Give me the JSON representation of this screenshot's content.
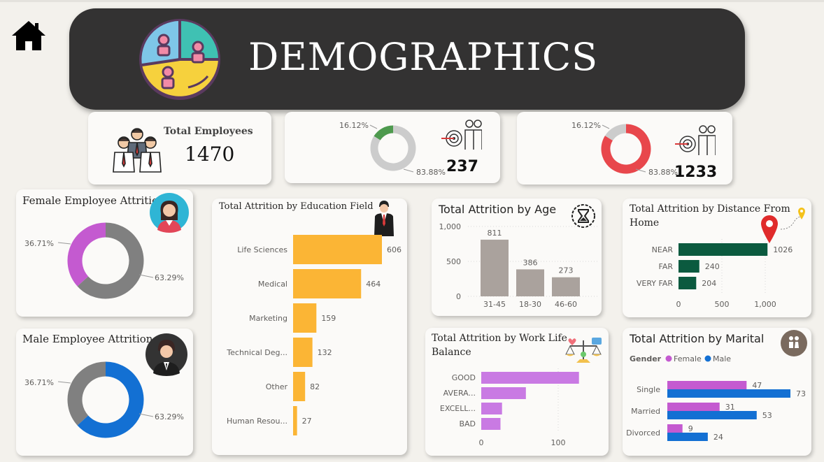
{
  "page": {
    "title": "DEMOGRAPHICS",
    "home_icon": "home-icon",
    "header_icon": "people-pie-icon"
  },
  "kpis": {
    "total_employees": {
      "label": "Total Employees",
      "value": "1470",
      "icon": "employees-group-icon"
    },
    "attrition_yes": {
      "value": "237",
      "pct_small": "16.12%",
      "pct_large": "83.88%",
      "small_fraction": 0.1612,
      "accent": "#4e9a4e",
      "icon": "target-team-icon"
    },
    "attrition_no": {
      "value": "1233",
      "pct_small": "16.12%",
      "pct_large": "83.88%",
      "small_fraction": 0.1612,
      "accent": "#e8474c",
      "icon": "target-team-icon"
    }
  },
  "female_attrition": {
    "title": "Female Employee Attrition",
    "icon": "female-avatar-icon",
    "pct_a": "36.71%",
    "pct_b": "63.29%",
    "fraction_a": 0.3671,
    "color_a": "#c45ad0",
    "color_b": "#808080"
  },
  "male_attrition": {
    "title": "Male Employee Attrition",
    "icon": "male-avatar-icon",
    "pct_a": "36.71%",
    "pct_b": "63.29%",
    "fraction_a": 0.3671,
    "color_a": "#808080",
    "color_b": "#1370d3"
  },
  "education": {
    "title": "Total Attrition by Education Field",
    "icon": "businessman-icon",
    "categories": [
      "Life Sciences",
      "Medical",
      "Marketing",
      "Technical Deg...",
      "Other",
      "Human Resou..."
    ],
    "values": [
      606,
      464,
      159,
      132,
      82,
      27
    ],
    "value_labels": [
      "606",
      "464",
      "159",
      "132",
      "82",
      "27"
    ],
    "color": "#fbb535"
  },
  "age": {
    "title": "Total Attrition by Age",
    "icon": "hourglass-icon",
    "categories": [
      "31-45",
      "18-30",
      "46-60"
    ],
    "values": [
      811,
      386,
      273
    ],
    "value_labels": [
      "811",
      "386",
      "273"
    ],
    "y_ticks": [
      "1,000",
      "500",
      "0"
    ],
    "color": "#aaa29d"
  },
  "distance": {
    "title": "Total Attrition by Distance From Home",
    "icon": "location-pin-icon",
    "categories": [
      "NEAR",
      "FAR",
      "VERY FAR"
    ],
    "values": [
      1026,
      240,
      204
    ],
    "value_labels": [
      "1026",
      "240",
      "204"
    ],
    "x_ticks": [
      "0",
      "500",
      "1,000"
    ],
    "color": "#0b5a3f"
  },
  "worklife": {
    "title": "Total Attrition by Work Life Balance",
    "icon": "balance-scale-icon",
    "categories": [
      "GOOD",
      "AVERA...",
      "EXCELL...",
      "BAD"
    ],
    "values": [
      127,
      58,
      27,
      25
    ],
    "x_ticks": [
      "0",
      "100"
    ],
    "color": "#c97ae3"
  },
  "marital": {
    "title": "Total Attrition by Marital",
    "icon": "couple-icon",
    "legend_title": "Gender",
    "legend": [
      "Female",
      "Male"
    ],
    "colors": [
      "#c45ad0",
      "#1370d3"
    ],
    "categories": [
      "Single",
      "Married",
      "Divorced"
    ],
    "female": [
      47,
      31,
      9
    ],
    "male": [
      73,
      53,
      24
    ],
    "female_labels": [
      "47",
      "31",
      "9"
    ],
    "male_labels": [
      "73",
      "53",
      "24"
    ]
  },
  "chart_data": [
    {
      "type": "pie",
      "title": "Female Employee Attrition",
      "labels": [
        "36.71%",
        "63.29%"
      ],
      "values": [
        36.71,
        63.29
      ]
    },
    {
      "type": "pie",
      "title": "Male Employee Attrition",
      "labels": [
        "36.71%",
        "63.29%"
      ],
      "values": [
        36.71,
        63.29
      ]
    },
    {
      "type": "pie",
      "labels": [
        "16.12%",
        "83.88%"
      ],
      "values": [
        16.12,
        83.88
      ]
    },
    {
      "type": "pie",
      "labels": [
        "16.12%",
        "83.88%"
      ],
      "values": [
        16.12,
        83.88
      ]
    },
    {
      "type": "bar",
      "title": "Total Attrition by Education Field",
      "categories": [
        "Life Sciences",
        "Medical",
        "Marketing",
        "Technical Deg...",
        "Other",
        "Human Resou..."
      ],
      "values": [
        606,
        464,
        159,
        132,
        82,
        27
      ]
    },
    {
      "type": "bar",
      "title": "Total Attrition by Age",
      "categories": [
        "31-45",
        "18-30",
        "46-60"
      ],
      "values": [
        811,
        386,
        273
      ],
      "ylim": [
        0,
        1000
      ]
    },
    {
      "type": "bar",
      "title": "Total Attrition by Distance From Home",
      "categories": [
        "NEAR",
        "FAR",
        "VERY FAR"
      ],
      "values": [
        1026,
        240,
        204
      ],
      "xlim": [
        0,
        1000
      ]
    },
    {
      "type": "bar",
      "title": "Total Attrition by Work Life Balance",
      "categories": [
        "GOOD",
        "AVERA...",
        "EXCELL...",
        "BAD"
      ],
      "values": [
        127,
        58,
        27,
        25
      ],
      "xlim": [
        0,
        100
      ]
    },
    {
      "type": "bar",
      "title": "Total Attrition by Marital",
      "categories": [
        "Single",
        "Married",
        "Divorced"
      ],
      "series": [
        {
          "name": "Female",
          "values": [
            47,
            31,
            9
          ]
        },
        {
          "name": "Male",
          "values": [
            73,
            53,
            24
          ]
        }
      ]
    }
  ]
}
